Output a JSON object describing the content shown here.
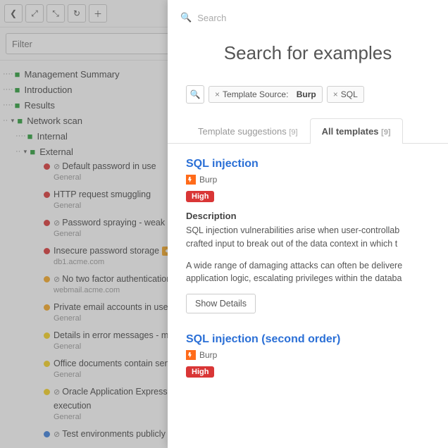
{
  "toolbar": {
    "back": "❮",
    "expand": "⤢",
    "collapse": "⤡",
    "refresh": "↻",
    "add": "＋"
  },
  "filter": {
    "placeholder": "Filter"
  },
  "tree": {
    "n0": "Management Summary",
    "n1": "Introduction",
    "n2": "Results",
    "n3": "Network scan",
    "n4": "Internal",
    "n5": "External",
    "findings": [
      {
        "sev": "red",
        "check": true,
        "label": "Default password in use",
        "sub": "General"
      },
      {
        "sev": "red",
        "check": false,
        "label": "HTTP request smuggling",
        "sub": "General"
      },
      {
        "sev": "red",
        "check": true,
        "label": "Password spraying - weak pa",
        "sub": "General"
      },
      {
        "sev": "red",
        "check": false,
        "label": "Insecure password storage",
        "badge": "●",
        "sub": "db1.acme.com"
      },
      {
        "sev": "orange",
        "check": true,
        "label": "No two factor authentication",
        "sub": "webmail.acme.com"
      },
      {
        "sev": "orange",
        "check": false,
        "label": "Private email accounts in use",
        "badge": "●",
        "sub": "General"
      },
      {
        "sev": "yellow",
        "check": false,
        "label": "Details in error messages - mdr",
        "sub": "General"
      },
      {
        "sev": "yellow",
        "check": false,
        "label": "Office documents contain sens",
        "sub": "General"
      },
      {
        "sev": "yellow",
        "check": true,
        "label": "Oracle Application Express re",
        "sub2": "execution",
        "sub": "General"
      },
      {
        "sev": "blue",
        "check": true,
        "label": "Test environments publicly a",
        "sub": ""
      }
    ]
  },
  "search": {
    "top": "Search",
    "title": "Search for examples"
  },
  "chips": {
    "c1_label": "Template Source:",
    "c1_val": "Burp",
    "c2_val": "SQL"
  },
  "tabs": {
    "t1": "Template suggestions",
    "t1c": "[9]",
    "t2": "All templates",
    "t2c": "[9]"
  },
  "r1": {
    "title": "SQL injection",
    "source": "Burp",
    "sev": "High",
    "dh": "Description",
    "p1": "SQL injection vulnerabilities arise when user-controllab",
    "p1b": "crafted input to break out of the data context in which t",
    "p2": "A wide range of damaging attacks can often be delivere",
    "p2b": "application logic, escalating privileges within the databa",
    "btn": "Show Details"
  },
  "r2": {
    "title": "SQL injection (second order)",
    "source": "Burp",
    "sev": "High"
  }
}
